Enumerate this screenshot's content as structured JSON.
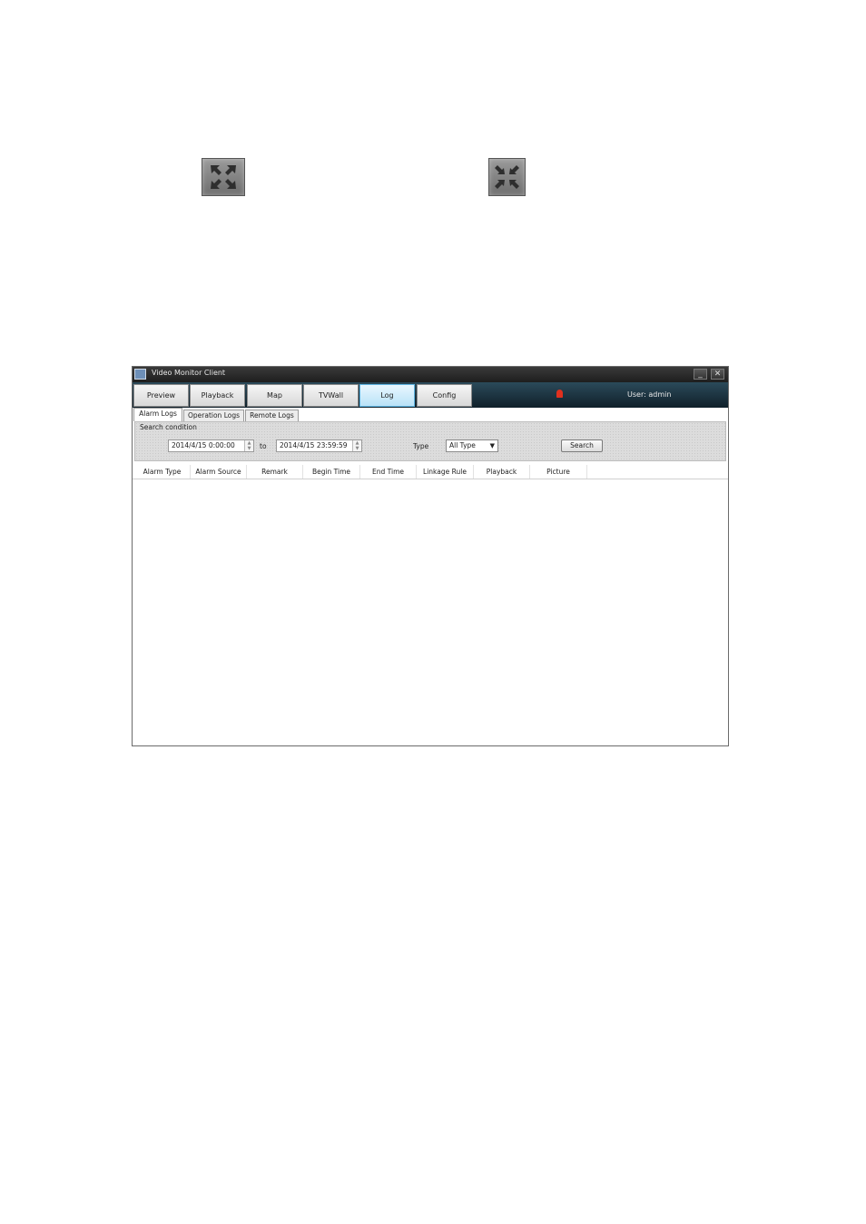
{
  "icons": {
    "maximize": "fullscreen-expand-icon",
    "restore": "fullscreen-collapse-icon"
  },
  "window": {
    "title": "Video Monitor Client",
    "minimize": "_",
    "close": "✕"
  },
  "nav": {
    "tabs": [
      "Preview",
      "Playback",
      "Map",
      "TVWall",
      "Log",
      "Config"
    ],
    "active": "Log",
    "user": "User: admin"
  },
  "subtabs": {
    "items": [
      "Alarm Logs",
      "Operation Logs",
      "Remote Logs"
    ],
    "active": "Alarm Logs"
  },
  "search": {
    "legend": "Search condition",
    "from": "2014/4/15 0:00:00",
    "to_label": "to",
    "to": "2014/4/15 23:59:59",
    "type_label": "Type",
    "type_value": "All Type",
    "button": "Search"
  },
  "table": {
    "columns": [
      "Alarm Type",
      "Alarm Source",
      "Remark",
      "Begin Time",
      "End Time",
      "Linkage Rule",
      "Playback",
      "Picture"
    ],
    "rows": []
  },
  "colors": {
    "nav_bg": "#10202a",
    "active_tab": "#b9e2f7",
    "alarm": "#e0301e"
  }
}
